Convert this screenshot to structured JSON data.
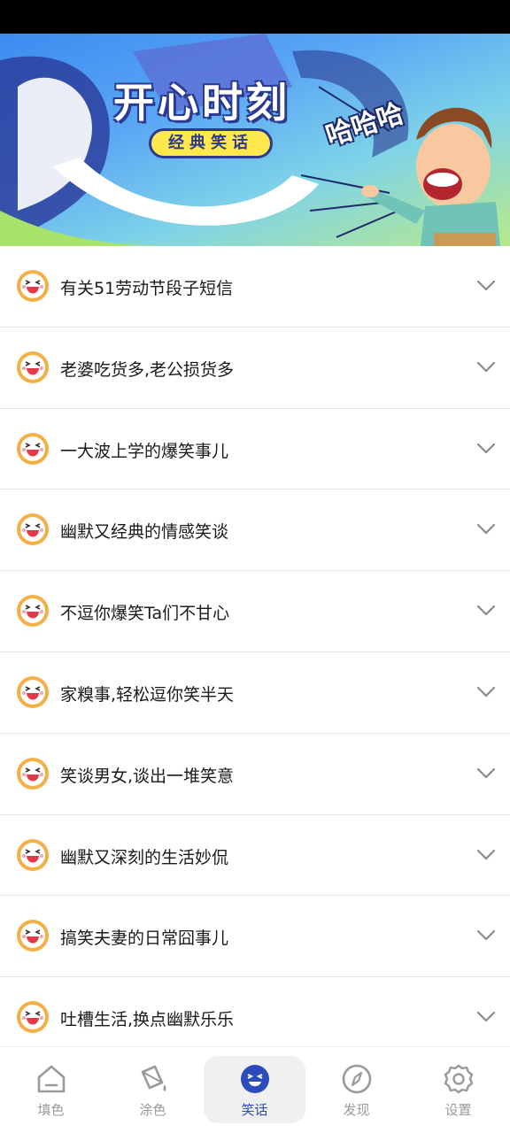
{
  "banner": {
    "title": "开心时刻",
    "subtitle": "经典笑话",
    "laugh_text": "哈哈哈"
  },
  "list": {
    "items": [
      {
        "label": "有关51劳动节段子短信"
      },
      {
        "label": "老婆吃货多,老公损货多"
      },
      {
        "label": "一大波上学的爆笑事儿"
      },
      {
        "label": "幽默又经典的情感笑谈"
      },
      {
        "label": "不逗你爆笑Ta们不甘心"
      },
      {
        "label": "家糗事,轻松逗你笑半天"
      },
      {
        "label": "笑谈男女,谈出一堆笑意"
      },
      {
        "label": "幽默又深刻的生活妙侃"
      },
      {
        "label": "搞笑夫妻的日常囧事儿"
      },
      {
        "label": "吐槽生活,换点幽默乐乐"
      }
    ],
    "item_icon": "laughing-face-icon",
    "expand_icon": "chevron-down-icon"
  },
  "tabbar": {
    "tabs": [
      {
        "label": "填色",
        "icon": "home-icon",
        "active": false
      },
      {
        "label": "涂色",
        "icon": "paint-bucket-icon",
        "active": false
      },
      {
        "label": "笑话",
        "icon": "smile-icon",
        "active": true
      },
      {
        "label": "发现",
        "icon": "compass-icon",
        "active": false
      },
      {
        "label": "设置",
        "icon": "gear-icon",
        "active": false
      }
    ]
  },
  "colors": {
    "accent": "#2d4bbd",
    "inactive": "#9a9a9a",
    "face": "#f2b046"
  }
}
